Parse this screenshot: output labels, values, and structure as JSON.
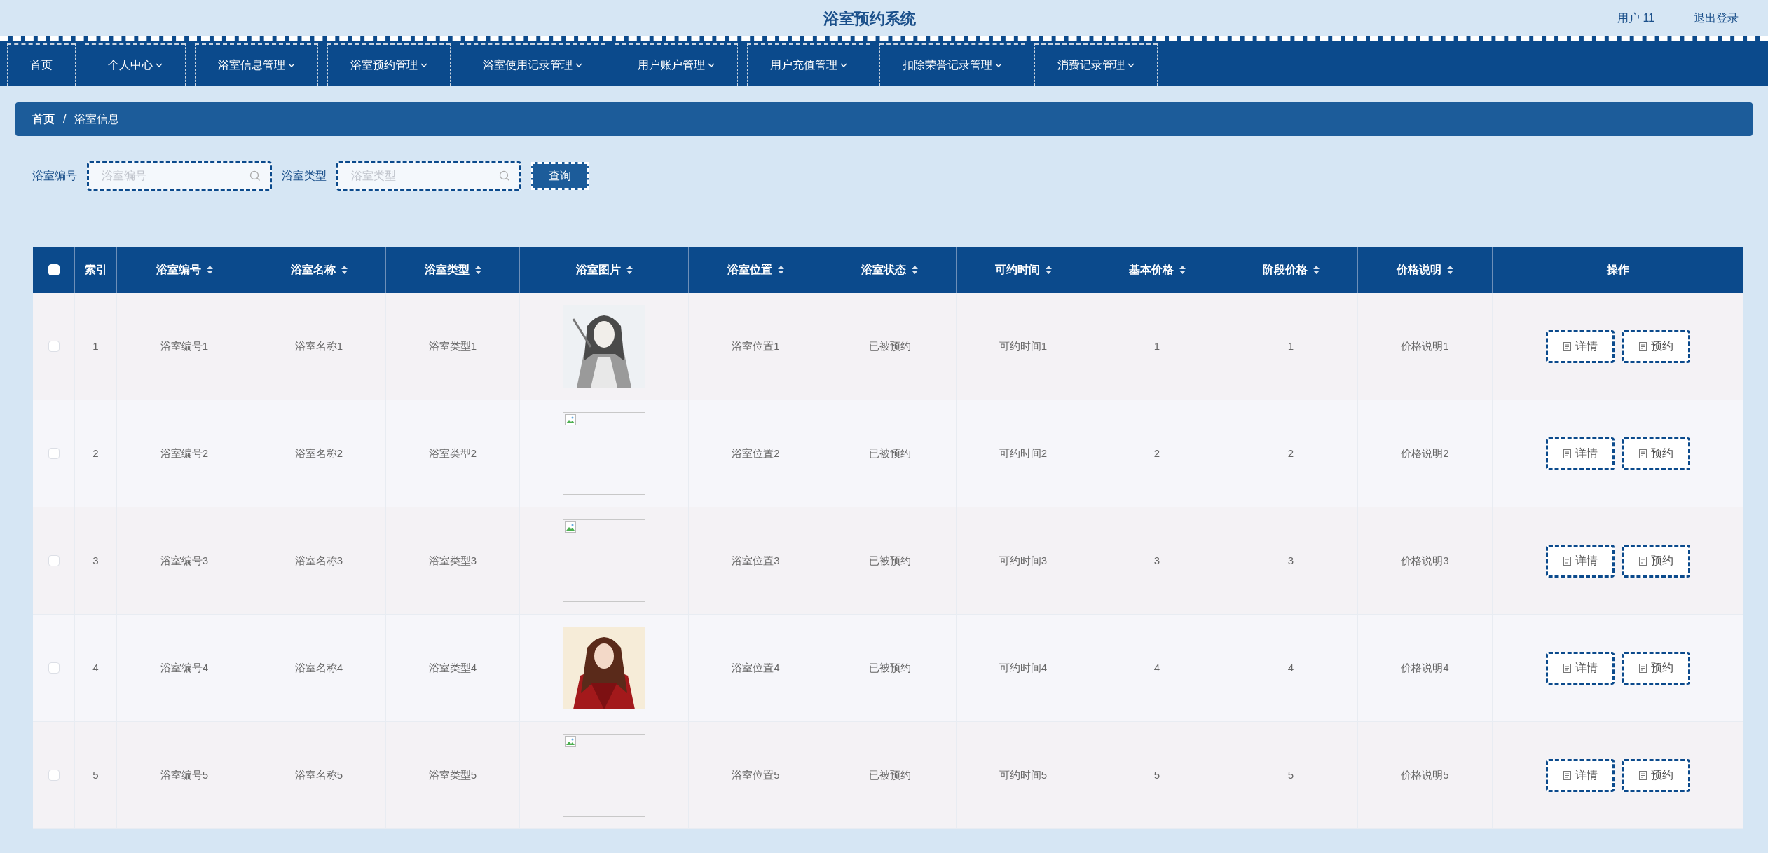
{
  "header": {
    "title": "浴室预约系统",
    "user": "用户 11",
    "logout": "退出登录"
  },
  "nav": [
    {
      "label": "首页",
      "dropdown": false
    },
    {
      "label": "个人中心",
      "dropdown": true
    },
    {
      "label": "浴室信息管理",
      "dropdown": true
    },
    {
      "label": "浴室预约管理",
      "dropdown": true
    },
    {
      "label": "浴室使用记录管理",
      "dropdown": true
    },
    {
      "label": "用户账户管理",
      "dropdown": true
    },
    {
      "label": "用户充值管理",
      "dropdown": true
    },
    {
      "label": "扣除荣誉记录管理",
      "dropdown": true
    },
    {
      "label": "消费记录管理",
      "dropdown": true
    }
  ],
  "breadcrumb": [
    "首页",
    "浴室信息"
  ],
  "breadcrumb_separator": "/",
  "search": {
    "fields": [
      {
        "label": "浴室编号",
        "placeholder": "浴室编号"
      },
      {
        "label": "浴室类型",
        "placeholder": "浴室类型"
      }
    ],
    "button": "查询"
  },
  "table": {
    "columns": [
      {
        "label": "索引",
        "sortable": false
      },
      {
        "label": "浴室编号",
        "sortable": true
      },
      {
        "label": "浴室名称",
        "sortable": true
      },
      {
        "label": "浴室类型",
        "sortable": true
      },
      {
        "label": "浴室图片",
        "sortable": true
      },
      {
        "label": "浴室位置",
        "sortable": true
      },
      {
        "label": "浴室状态",
        "sortable": true
      },
      {
        "label": "可约时间",
        "sortable": true
      },
      {
        "label": "基本价格",
        "sortable": true
      },
      {
        "label": "阶段价格",
        "sortable": true
      },
      {
        "label": "价格说明",
        "sortable": true
      },
      {
        "label": "操作",
        "sortable": false
      }
    ],
    "all_checked": false,
    "rows": [
      {
        "checked": false,
        "index": "1",
        "code": "浴室编号1",
        "name": "浴室名称1",
        "type": "浴室类型1",
        "location": "浴室位置1",
        "status": "已被预约",
        "time": "可约时间1",
        "base_price": "1",
        "stage_price": "1",
        "price_note": "价格说明1",
        "actions": [
          "详情",
          "预约"
        ]
      },
      {
        "checked": false,
        "index": "2",
        "code": "浴室编号2",
        "name": "浴室名称2",
        "type": "浴室类型2",
        "image": {
          "kind": "broken"
        },
        "location": "浴室位置2",
        "status": "已被预约",
        "time": "可约时间2",
        "base_price": "2",
        "stage_price": "2",
        "price_note": "价格说明2",
        "actions": [
          "详情",
          "预约"
        ]
      },
      {
        "checked": false,
        "index": "3",
        "code": "浴室编号3",
        "name": "浴室名称3",
        "type": "浴室类型3",
        "image": {
          "kind": "broken"
        },
        "location": "浴室位置3",
        "status": "已被预约",
        "time": "可约时间3",
        "base_price": "3",
        "stage_price": "3",
        "price_note": "价格说明3",
        "actions": [
          "详情",
          "预约"
        ]
      },
      {
        "checked": false,
        "index": "4",
        "code": "浴室编号4",
        "name": "浴室名称4",
        "type": "浴室类型4",
        "location": "浴室位置4",
        "status": "已被预约",
        "time": "可约时间4",
        "base_price": "4",
        "stage_price": "4",
        "price_note": "价格说明4",
        "actions": [
          "详情",
          "预约"
        ]
      },
      {
        "checked": false,
        "index": "5",
        "code": "浴室编号5",
        "name": "浴室名称5",
        "type": "浴室类型5",
        "image": {
          "kind": "broken"
        },
        "location": "浴室位置5",
        "status": "已被预约",
        "time": "可约时间5",
        "base_price": "5",
        "stage_price": "5",
        "price_note": "价格说明5",
        "actions": [
          "详情",
          "预约"
        ]
      }
    ]
  }
}
